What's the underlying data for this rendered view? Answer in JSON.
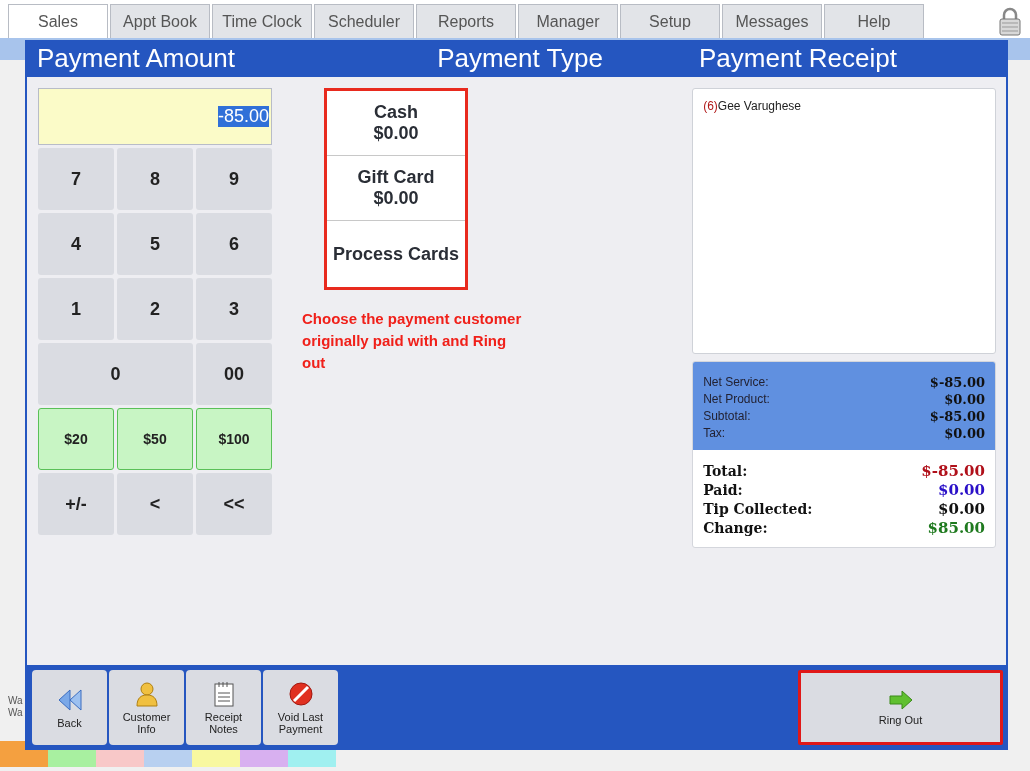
{
  "tabs": [
    {
      "label": "Sales",
      "selected": true
    },
    {
      "label": "Appt Book",
      "selected": false
    },
    {
      "label": "Time Clock",
      "selected": false
    },
    {
      "label": "Scheduler",
      "selected": false
    },
    {
      "label": "Reports",
      "selected": false
    },
    {
      "label": "Manager",
      "selected": false
    },
    {
      "label": "Setup",
      "selected": false
    },
    {
      "label": "Messages",
      "selected": false
    },
    {
      "label": "Help",
      "selected": false
    }
  ],
  "background": {
    "side_labels": [
      "Wa",
      "Wa"
    ],
    "color_tabs": [
      {
        "color": "#f4a040"
      },
      {
        "color": "#a8f0a0"
      },
      {
        "color": "#f8c8c8"
      },
      {
        "color": "#b8d0f0"
      },
      {
        "color": "#f8f8a0"
      },
      {
        "color": "#d8b0f0"
      },
      {
        "color": "#a0f0f0"
      }
    ]
  },
  "dialog": {
    "headers": [
      "Payment Amount",
      "Payment Type",
      "Payment Receipt"
    ],
    "amount": {
      "value": "-85.00",
      "value_selected": true
    },
    "keypad": [
      {
        "label": "7",
        "kind": "digit"
      },
      {
        "label": "8",
        "kind": "digit"
      },
      {
        "label": "9",
        "kind": "digit"
      },
      {
        "label": "4",
        "kind": "digit"
      },
      {
        "label": "5",
        "kind": "digit"
      },
      {
        "label": "6",
        "kind": "digit"
      },
      {
        "label": "1",
        "kind": "digit"
      },
      {
        "label": "2",
        "kind": "digit"
      },
      {
        "label": "3",
        "kind": "digit"
      },
      {
        "label": "0",
        "kind": "wide"
      },
      {
        "label": "00",
        "kind": "digit"
      },
      {
        "label": "$20",
        "kind": "cash"
      },
      {
        "label": "$50",
        "kind": "cash"
      },
      {
        "label": "$100",
        "kind": "cash"
      },
      {
        "label": "+/-",
        "kind": "digit"
      },
      {
        "label": "<",
        "kind": "digit"
      },
      {
        "label": "<<",
        "kind": "digit"
      }
    ],
    "payment_types": {
      "outlined": true,
      "items": [
        {
          "label": "Cash",
          "amount": "$0.00"
        },
        {
          "label": "Gift Card",
          "amount": "$0.00"
        },
        {
          "label": "Process Cards"
        }
      ]
    },
    "instruction": "Choose the payment customer originally paid with and Ring out",
    "receipt": {
      "ticket_number": "(6)",
      "customer": "Gee Varughese"
    },
    "subtotals": [
      {
        "label": "Net Service:",
        "value": "$-85.00"
      },
      {
        "label": "Net Product:",
        "value": "$0.00"
      },
      {
        "label": "Subtotal:",
        "value": "$-85.00"
      },
      {
        "label": "Tax:",
        "value": "$0.00"
      }
    ],
    "totals": [
      {
        "label": "Total:",
        "value": "$-85.00",
        "color": "#b0101a"
      },
      {
        "label": "Paid:",
        "value": "$0.00",
        "color": "#2a10c8"
      },
      {
        "label": "Tip Collected:",
        "value": "$0.00",
        "color": "#111111"
      },
      {
        "label": "Change:",
        "value": "$85.00",
        "color": "#1f7a1f"
      }
    ],
    "footer_buttons": [
      {
        "label": "Back"
      },
      {
        "label": "Customer Info"
      },
      {
        "label": "Receipt Notes"
      },
      {
        "label": "Void Last Payment"
      }
    ],
    "ring_out": {
      "label": "Ring Out",
      "outlined": true
    }
  }
}
